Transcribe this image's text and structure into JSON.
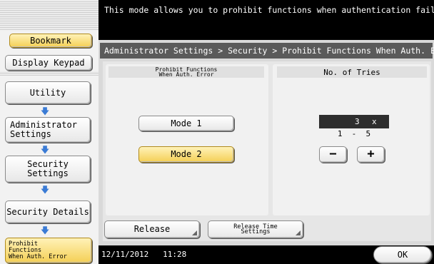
{
  "message": "This mode allows you to prohibit functions when authentication fails.",
  "left_nav": {
    "bookmark": "Bookmark",
    "display_keypad": "Display Keypad",
    "utility": "Utility",
    "administrator_settings_1": "Administrator",
    "administrator_settings_2": "Settings",
    "security_settings_1": "Security",
    "security_settings_2": "Settings",
    "security_details": "Security Details",
    "prohibit_1": "Prohibit",
    "prohibit_2": "Functions",
    "prohibit_3": "When Auth. Error",
    "arrow_icon": "down-arrow-icon"
  },
  "breadcrumb": "Administrator Settings > Security > Prohibit Functions When Auth. Error",
  "prohibit_panel": {
    "title_1": "Prohibit Functions",
    "title_2": "When Auth. Error",
    "mode1": "Mode 1",
    "mode2": "Mode 2",
    "selected": "Mode 2"
  },
  "tries_panel": {
    "title": "No. of Tries",
    "value": "3",
    "unit": "x",
    "range": "1  -  5",
    "minus": "−",
    "plus": "+"
  },
  "bottom_buttons": {
    "release": "Release",
    "release_time_1": "Release Time",
    "release_time_2": "Settings"
  },
  "status": {
    "datetime": "12/11/2012   11:28",
    "ok": "OK"
  },
  "colors": {
    "selected_yellow": "#f4cf55",
    "arrow_blue": "#3a7bd5",
    "value_box": "#2e2e2e"
  }
}
